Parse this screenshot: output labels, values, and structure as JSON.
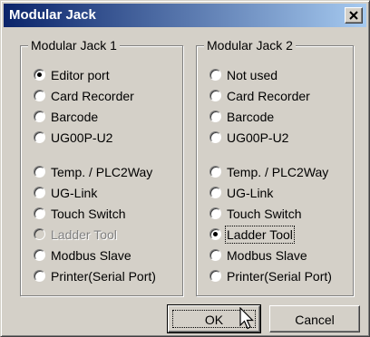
{
  "window": {
    "title": "Modular Jack",
    "close_glyph": "✕"
  },
  "groups": [
    {
      "caption": "Modular Jack 1",
      "options": [
        {
          "label": "Editor port",
          "checked": true,
          "disabled": false
        },
        {
          "label": "Card Recorder",
          "checked": false,
          "disabled": false
        },
        {
          "label": "Barcode",
          "checked": false,
          "disabled": false
        },
        {
          "label": "UG00P-U2",
          "checked": false,
          "disabled": false
        },
        {
          "label": "Temp. / PLC2Way",
          "checked": false,
          "disabled": false
        },
        {
          "label": "UG-Link",
          "checked": false,
          "disabled": false
        },
        {
          "label": "Touch Switch",
          "checked": false,
          "disabled": false
        },
        {
          "label": "Ladder Tool",
          "checked": false,
          "disabled": true
        },
        {
          "label": "Modbus Slave",
          "checked": false,
          "disabled": false
        },
        {
          "label": "Printer(Serial Port)",
          "checked": false,
          "disabled": false
        }
      ]
    },
    {
      "caption": "Modular Jack 2",
      "options": [
        {
          "label": "Not used",
          "checked": false,
          "disabled": false
        },
        {
          "label": "Card Recorder",
          "checked": false,
          "disabled": false
        },
        {
          "label": "Barcode",
          "checked": false,
          "disabled": false
        },
        {
          "label": "UG00P-U2",
          "checked": false,
          "disabled": false
        },
        {
          "label": "Temp. / PLC2Way",
          "checked": false,
          "disabled": false
        },
        {
          "label": "UG-Link",
          "checked": false,
          "disabled": false
        },
        {
          "label": "Touch Switch",
          "checked": false,
          "disabled": false
        },
        {
          "label": "Ladder Tool",
          "checked": true,
          "disabled": false,
          "focused": true
        },
        {
          "label": "Modbus Slave",
          "checked": false,
          "disabled": false
        },
        {
          "label": "Printer(Serial Port)",
          "checked": false,
          "disabled": false
        }
      ]
    }
  ],
  "buttons": {
    "ok_label": "OK",
    "cancel_label": "Cancel"
  },
  "colors": {
    "titlebar_start": "#0a246a",
    "titlebar_end": "#a6caf0",
    "face": "#d4d0c8"
  },
  "icons": {
    "close": "close-icon",
    "cursor": "mouse-pointer-icon"
  }
}
